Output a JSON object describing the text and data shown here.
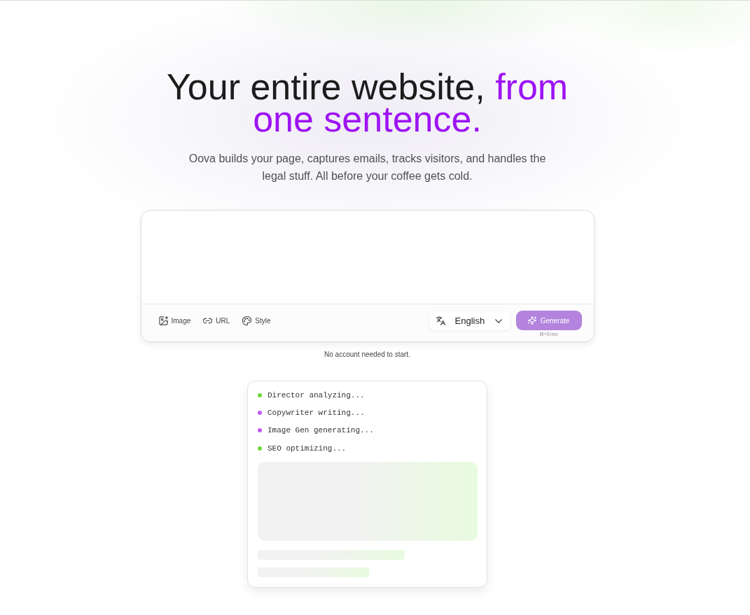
{
  "hero": {
    "headline": "Your entire website,",
    "headline_highlight": "from one sentence.",
    "subtitle": "Oova builds your page, captures emails, tracks visitors, and handles the legal stuff. All before your coffee gets cold."
  },
  "prompt": {
    "tools": [
      {
        "kind": "image",
        "label": "Image"
      },
      {
        "kind": "link",
        "label": "URL"
      },
      {
        "kind": "style",
        "label": "Style"
      }
    ],
    "language": {
      "value": "English"
    },
    "generate": {
      "label": "Generate",
      "disabled": true,
      "shortcut": "⌘+Enter"
    }
  },
  "note": "No account needed to start.",
  "progress": {
    "agents": [
      {
        "label": "Director analyzing...",
        "color": "#6fd83c"
      },
      {
        "label": "Copywriter writing...",
        "color": "#c05cf2"
      },
      {
        "label": "Image Gen generating...",
        "color": "#c05cf2"
      },
      {
        "label": "SEO optimizing...",
        "color": "#6fd83c"
      }
    ]
  }
}
